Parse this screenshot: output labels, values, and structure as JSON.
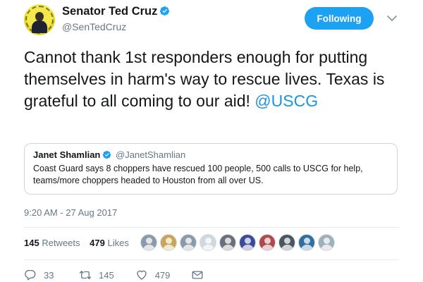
{
  "author": {
    "name": "Senator Ted Cruz",
    "handle": "@SenTedCruz",
    "avatar_icon": "profile-avatar",
    "verified_icon": "verified-badge-icon"
  },
  "follow_button": {
    "label": "Following",
    "color": "#1da1f2"
  },
  "menu_icon": "chevron-down-icon",
  "tweet": {
    "text": "Cannot thank 1st responders enough for putting themselves in harm's way to rescue lives. Texas is grateful to all coming to our aid!",
    "mention": "@USCG",
    "mention_color": "#1b95e0"
  },
  "quoted_tweet": {
    "name": "Janet Shamlian",
    "handle": "@JanetShamlian",
    "text": "Coast Guard says 8 choppers have rescued 100 people, 500 calls to USCG for help, teams/more choppers headed to Houston from all over US."
  },
  "timestamp": "9:20 AM - 27 Aug 2017",
  "stats": {
    "retweets_count": "145",
    "retweets_label": "Retweets",
    "likes_count": "479",
    "likes_label": "Likes"
  },
  "liker_avatars": [
    {
      "color": "#8a9aa8"
    },
    {
      "color": "#c9a55a"
    },
    {
      "color": "#8a9aa8"
    },
    {
      "color": "#cfd8df"
    },
    {
      "color": "#6a6f7a"
    },
    {
      "color": "#3b4a9a"
    },
    {
      "color": "#b04a4a"
    },
    {
      "color": "#4a5560"
    },
    {
      "color": "#2f6fa0"
    },
    {
      "color": "#9fb0bd"
    }
  ],
  "actions": {
    "reply": {
      "icon": "reply-icon",
      "count": "33"
    },
    "retweet": {
      "icon": "retweet-icon",
      "count": "145"
    },
    "like": {
      "icon": "heart-icon",
      "count": "479"
    },
    "message": {
      "icon": "mail-icon"
    }
  }
}
